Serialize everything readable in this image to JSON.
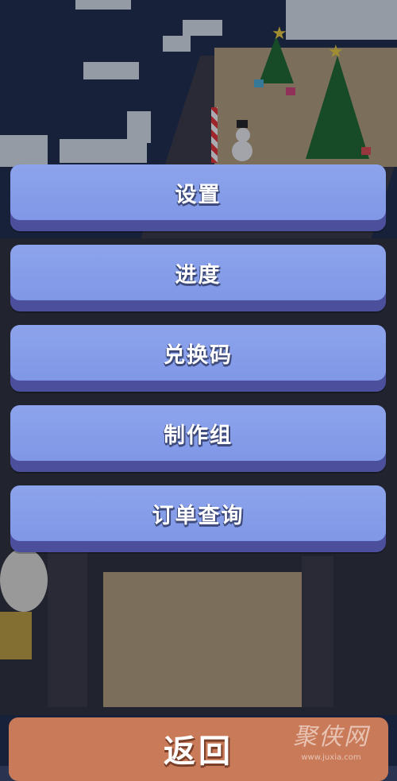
{
  "menu": {
    "items": [
      {
        "label": "设置"
      },
      {
        "label": "进度"
      },
      {
        "label": "兑换码"
      },
      {
        "label": "制作组"
      },
      {
        "label": "订单查询"
      }
    ]
  },
  "back_button": {
    "label": "返回"
  },
  "watermark": {
    "name": "聚侠网",
    "url": "www.juxia.com"
  },
  "colors": {
    "button_face": "#8da4ec",
    "button_shadow": "#4b4f9c",
    "back_button": "#c97a58",
    "sea": "#1f2c4a"
  }
}
